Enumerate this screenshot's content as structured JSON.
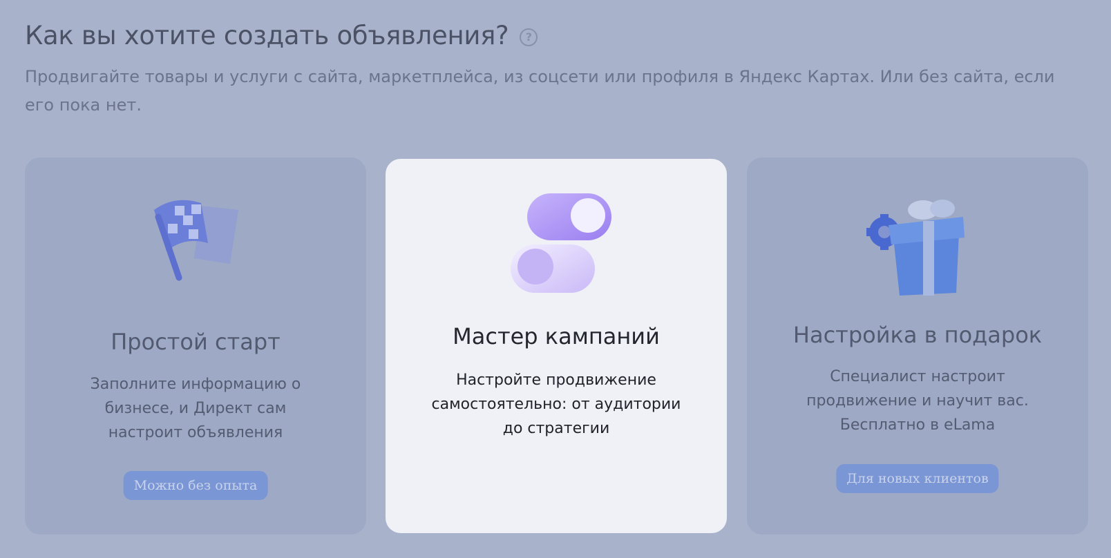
{
  "header": {
    "title": "Как вы хотите создать объявления?",
    "help_glyph": "?",
    "subtitle": "Продвигайте товары и услуги с сайта, маркетплейса, из соцсети или профиля в Яндекс Картах. Или без сайта, если его пока нет."
  },
  "cards": [
    {
      "title": "Простой старт",
      "text": "Заполните информацию о бизнесе, и Директ сам настроит объявления",
      "badge": "Можно без опыта",
      "icon": "checkered-flag-icon",
      "selected": false
    },
    {
      "title": "Мастер кампаний",
      "text": "Настройте продвижение самостоятельно: от аудитории до стратегии",
      "icon": "toggle-switches-icon",
      "selected": true
    },
    {
      "title": "Настройка в подарок",
      "text": "Специалист настроит продвижение и научит вас. Бесплатно в eLama",
      "badge": "Для новых клиентов",
      "icon": "gift-box-gear-icon",
      "selected": false
    }
  ],
  "colors": {
    "background": "#a8b2cb",
    "card_dim": "#9ea9c5",
    "card_active": "#eff1f6",
    "badge": "#7a96d4",
    "accent_purple": "#b49cf5"
  }
}
